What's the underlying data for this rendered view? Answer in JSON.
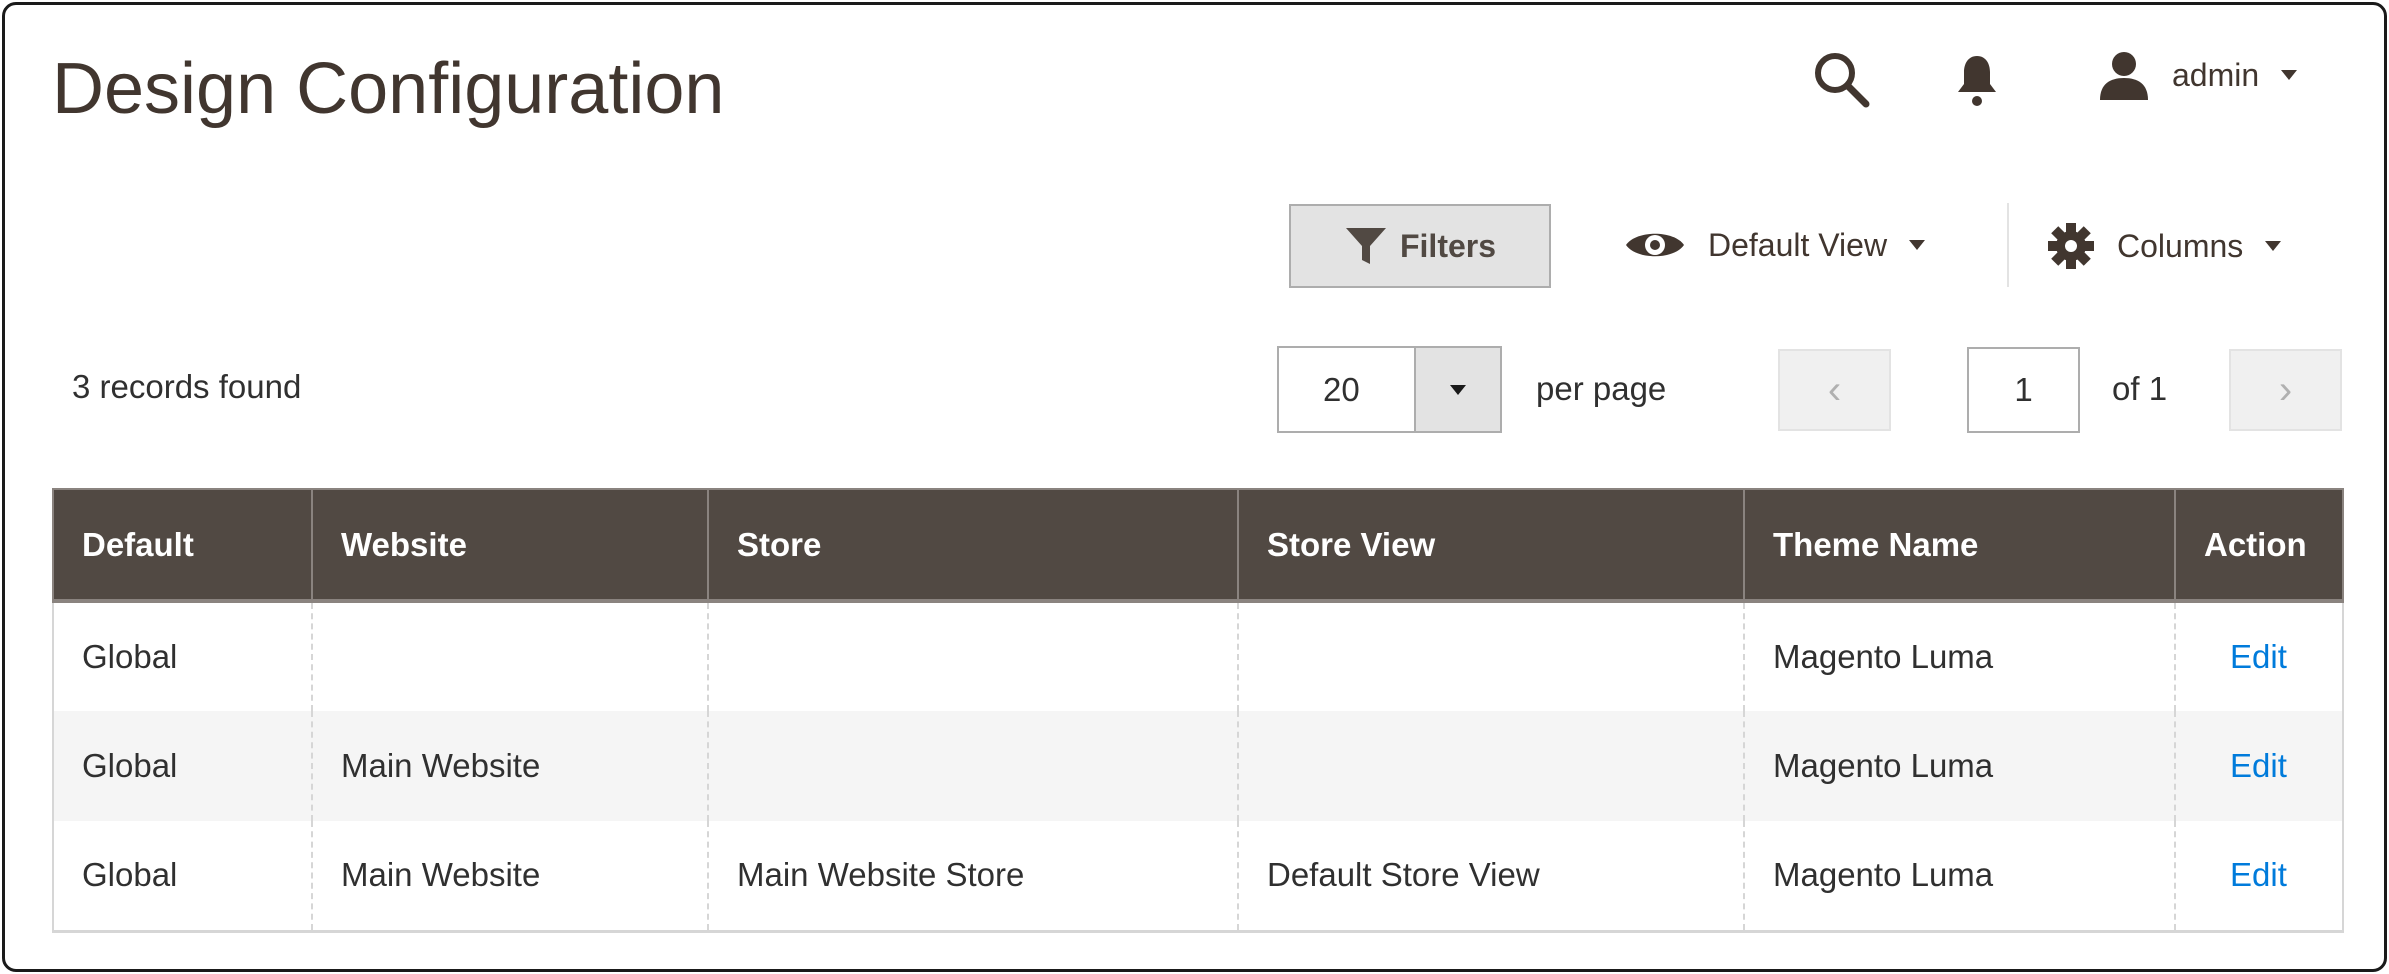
{
  "header": {
    "title": "Design Configuration",
    "user": "admin",
    "icons": [
      "search-icon",
      "bell-icon",
      "user-icon"
    ]
  },
  "toolbar": {
    "filters_label": "Filters",
    "view_label": "Default View",
    "columns_label": "Columns"
  },
  "grid": {
    "records_found": "3 records found",
    "per_page_value": "20",
    "per_page_label": "per page",
    "current_page": "1",
    "page_total": "of 1",
    "columns": [
      "Default",
      "Website",
      "Store",
      "Store View",
      "Theme Name",
      "Action"
    ],
    "rows": [
      [
        "Global",
        "",
        "",
        "",
        "Magento Luma",
        "Edit"
      ],
      [
        "Global",
        "Main Website",
        "",
        "",
        "Magento Luma",
        "Edit"
      ],
      [
        "Global",
        "Main Website",
        "Main Website Store",
        "Default Store View",
        "Magento Luma",
        "Edit"
      ]
    ]
  },
  "colors": {
    "header_bg": "#514943",
    "link": "#007bdb",
    "title": "#41362f"
  }
}
